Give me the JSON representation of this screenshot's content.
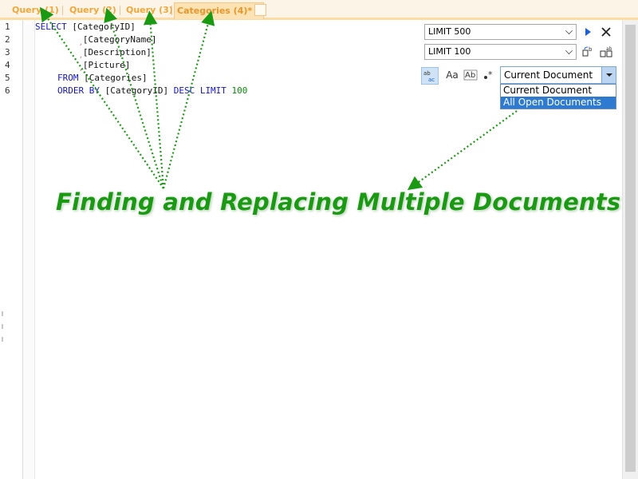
{
  "tabs": [
    {
      "label": "Query (1)"
    },
    {
      "label": "Query (2)"
    },
    {
      "label": "Query (3)"
    },
    {
      "label": "Categories (4)*",
      "close": "×"
    }
  ],
  "editor": {
    "line_numbers": [
      "1",
      "2",
      "3",
      "4",
      "5",
      "6"
    ],
    "lines": [
      {
        "kw": "SELECT",
        "rest": " [CategoryID]"
      },
      {
        "comma": ",",
        "rest": "[CategoryName]"
      },
      {
        "comma": ",",
        "rest": "[Description]"
      },
      {
        "comma": ",",
        "rest": "[Picture]"
      },
      {
        "kw": "FROM",
        "rest": " [Categories]"
      },
      {
        "kw": "ORDER BY",
        "rest": " [CategoryID] ",
        "kw2": "DESC LIMIT",
        "num": " 100"
      }
    ]
  },
  "toolbar": {
    "limit1": "LIMIT 500",
    "limit2": "LIMIT 100",
    "scope_selected": "Current Document",
    "scope_options": [
      "Current Document",
      "All Open Documents"
    ],
    "regex_label": "ab ac",
    "case_label": "Aa",
    "word_label": "Ab",
    "wildcard_label": "•*"
  },
  "caption": "Finding and Replacing Multiple Documents",
  "colors": {
    "tab_text": "#f0a73c",
    "keyword": "#1515c7",
    "number": "#0a8a0a",
    "caption": "#1a9a12",
    "arrow": "#1a9a12",
    "selection": "#2d7ad0"
  }
}
